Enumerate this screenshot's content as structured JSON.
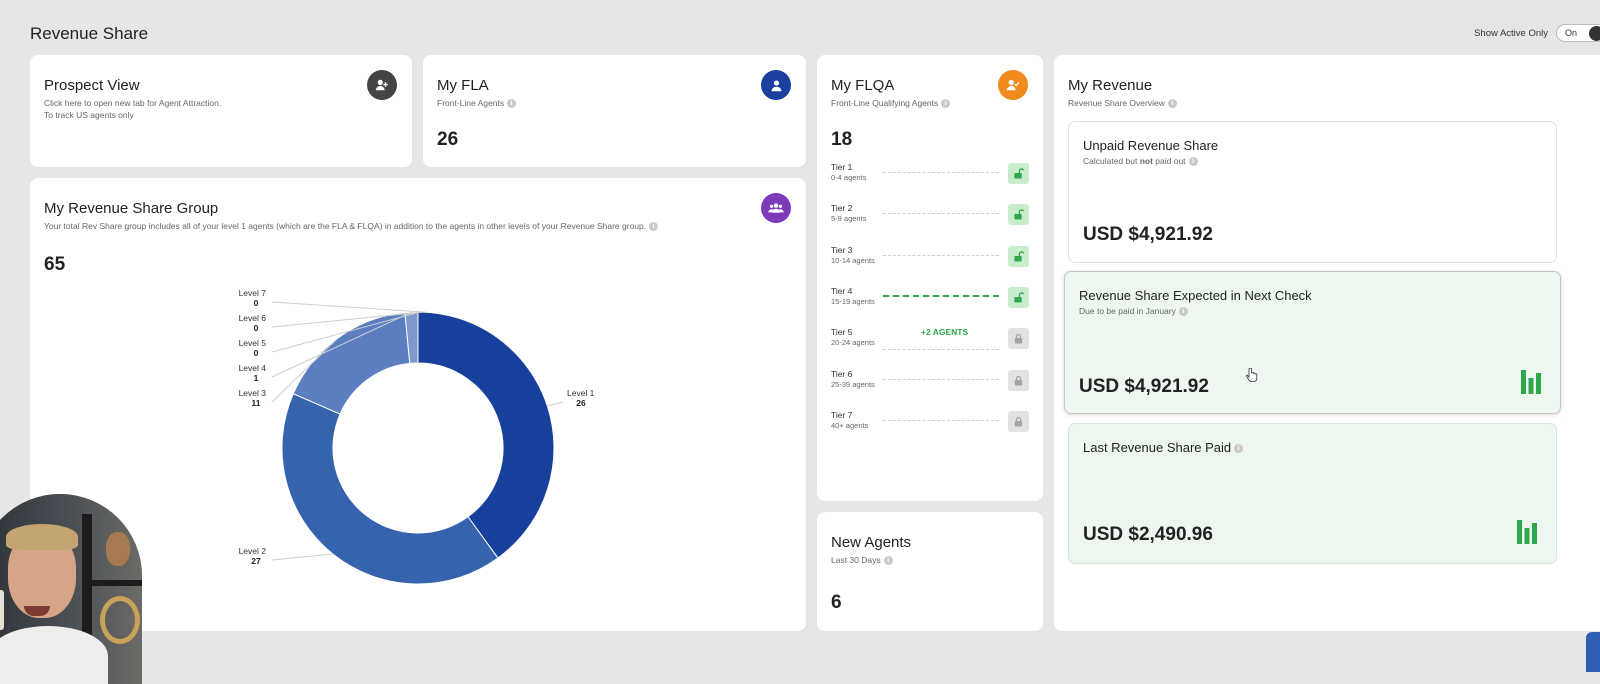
{
  "page": {
    "title": "Revenue Share"
  },
  "toggle": {
    "label": "Show Active Only",
    "state": "On"
  },
  "prospect": {
    "title": "Prospect View",
    "line1": "Click here to open new tab for Agent Attraction.",
    "line2": "To track US agents only",
    "icon": "add-user-icon"
  },
  "fla": {
    "title": "My FLA",
    "subtitle": "Front-Line Agents",
    "count": "26",
    "icon": "user-icon",
    "color": "#1a3f9c"
  },
  "group": {
    "title": "My Revenue Share Group",
    "subtitle": "Your total Rev Share group includes all of your level 1 agents (which are the FLA & FLQA) in addition to the agents in other levels of your Revenue Share group.",
    "count": "65",
    "icon": "group-icon",
    "color": "#7b3bb8"
  },
  "chart_data": {
    "type": "pie",
    "categories": [
      "Level 1",
      "Level 2",
      "Level 3",
      "Level 4",
      "Level 5",
      "Level 6",
      "Level 7"
    ],
    "values": [
      26,
      27,
      11,
      1,
      0,
      0,
      0
    ],
    "value_labels": [
      "26",
      "27",
      "11",
      "1",
      "0",
      "0",
      "0"
    ],
    "colors": [
      "#173f9c",
      "#3563ad",
      "#5a7ec0",
      "#8099cc",
      "#a6b6da",
      "#c3cde7",
      "#dde3f1"
    ],
    "donut": true
  },
  "flqa": {
    "title": "My FLQA",
    "subtitle": "Front-Line Qualifying Agents",
    "count": "18",
    "icon": "user-check-icon",
    "color": "#f08a1c",
    "tiers": [
      {
        "name": "Tier 1",
        "range": "0-4 agents",
        "unlocked": true,
        "active": false,
        "extra": ""
      },
      {
        "name": "Tier 2",
        "range": "5-9 agents",
        "unlocked": true,
        "active": false,
        "extra": ""
      },
      {
        "name": "Tier 3",
        "range": "10-14 agents",
        "unlocked": true,
        "active": false,
        "extra": ""
      },
      {
        "name": "Tier 4",
        "range": "15-19 agents",
        "unlocked": true,
        "active": true,
        "extra": ""
      },
      {
        "name": "Tier 5",
        "range": "20-24 agents",
        "unlocked": false,
        "active": false,
        "extra": "+2 AGENTS"
      },
      {
        "name": "Tier 6",
        "range": "25-39 agents",
        "unlocked": false,
        "active": false,
        "extra": ""
      },
      {
        "name": "Tier 7",
        "range": "40+ agents",
        "unlocked": false,
        "active": false,
        "extra": ""
      }
    ]
  },
  "new_agents": {
    "title": "New Agents",
    "subtitle": "Last 30 Days",
    "count": "6"
  },
  "revenue": {
    "title": "My Revenue",
    "subtitle": "Revenue Share Overview",
    "unpaid": {
      "title": "Unpaid Revenue Share",
      "sub_pre": "Calculated but ",
      "sub_bold": "not",
      "sub_post": " paid out",
      "amount": "USD $4,921.92"
    },
    "expected": {
      "title": "Revenue Share Expected in Next Check",
      "subtitle": "Due to be paid in January",
      "amount": "USD $4,921.92"
    },
    "last": {
      "title": "Last Revenue Share Paid",
      "amount": "USD $2,490.96"
    },
    "accent": "#2ea84a"
  }
}
